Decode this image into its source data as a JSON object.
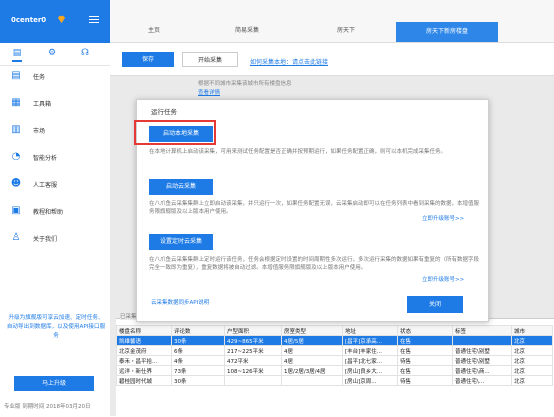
{
  "sidebar": {
    "username": "0center0",
    "tabs": [
      "clipboard-icon",
      "settings-icon",
      "headset-icon"
    ],
    "items": [
      {
        "label": "任务",
        "icon": "task-icon"
      },
      {
        "label": "工具箱",
        "icon": "toolbox-icon"
      },
      {
        "label": "市场",
        "icon": "market-icon"
      },
      {
        "label": "智能分析",
        "icon": "analysis-icon"
      },
      {
        "label": "人工客服",
        "icon": "support-icon"
      },
      {
        "label": "教程和帮助",
        "icon": "help-icon"
      },
      {
        "label": "关于我们",
        "icon": "about-icon"
      }
    ],
    "promo": "升级为旗舰版可享云加速、定时任务、自动导出到数据库，以及使用API接口服务",
    "upgrade_label": "马上升级",
    "footer": "专业版 到期时间 2018年03月20日"
  },
  "tabs": [
    "主页",
    "简易采集",
    "房天下",
    "房天下新房楼盘"
  ],
  "toolbar": {
    "save_label": "保存",
    "start_label": "开始采集",
    "help_link": "如何采集本地：请点击此链接"
  },
  "notice": {
    "line1": "根据不同城市采集该城市所有楼盘信息",
    "line2": "查看详情"
  },
  "modal": {
    "title": "运行任务",
    "local_button": "启动本地采集",
    "local_desc": "在本地计算机上启动该采集，可用来测试任务配置是否正确并按预期运行，如果任务配置正确，则可以本机完成采集任务。",
    "cloud_button": "启动云采集",
    "cloud_desc": "在八爪鱼云采集集群上立即启动该采集，并只运行一次，如果任务配置无误，云采集启动即可以在任务列表中看到采集的数据，本增值服务限旗舰版及以上版本用户使用。",
    "cloud_link": "立即升级账号>>",
    "schedule_button": "设置定时云采集",
    "schedule_desc": "在八爪鱼云采集集群上定时运行该任务，任务会根据定时设置的时间周期性多次运行，多次运行采集的数据如果有重复的（所有数据字段完全一致即为重复），重复数据将被自动过滤。本增值服务限旗舰版及以上版本用户使用。",
    "schedule_link": "立即升级账号>>",
    "api_link": "云采集数据同步API说明",
    "close_label": "关闭"
  },
  "grid": {
    "caption": "已采集",
    "headers": [
      "楼盘名称",
      "评论数",
      "户型面积",
      "房室类型",
      "地址",
      "状态",
      "标签",
      "城市"
    ],
    "rows": [
      [
        "凯维馨语",
        "30条",
        "429~865平米",
        "4居/5居",
        "[昌平]京承高...",
        "在售",
        "",
        "北京"
      ],
      [
        "北京金茂府",
        "6条",
        "217~225平米",
        "4居",
        "[丰台]丰家住...",
        "在售",
        "普通住宅\\别墅",
        "北京"
      ],
      [
        "泰禾・昌平拾...",
        "4条",
        "472平米",
        "4居",
        "[昌平]北七家...",
        "待售",
        "普通住宅\\别墅",
        "北京"
      ],
      [
        "远洋・新仕界",
        "73条",
        "108~126平米",
        "1居/2居/3居/4居",
        "[房山]良乡大...",
        "在售",
        "普通住宅\\商...",
        "北京"
      ],
      [
        "碧桂园时代城",
        "30条",
        "",
        "",
        "[房山]京周...",
        "待售",
        "普通住宅\\...",
        "北京"
      ]
    ]
  }
}
